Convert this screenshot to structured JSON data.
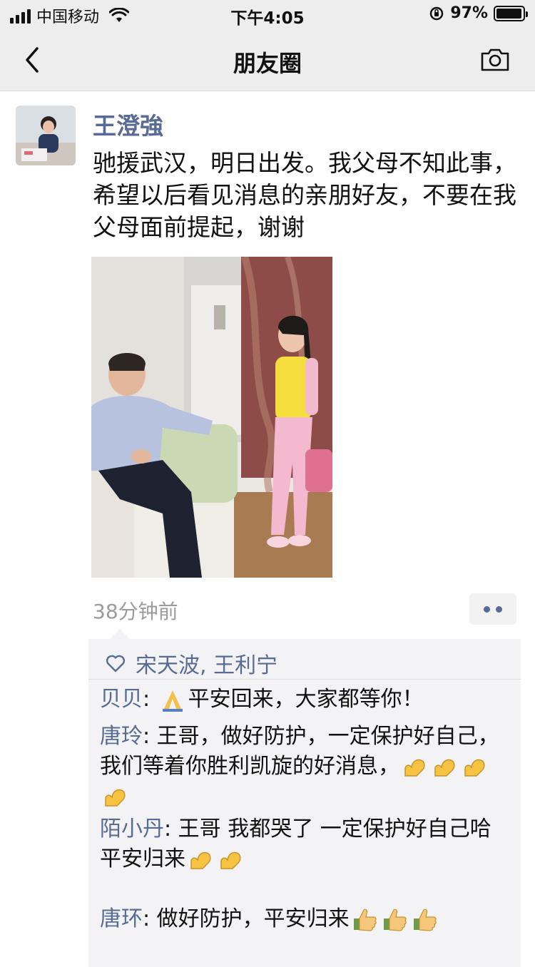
{
  "status_bar": {
    "carrier": "中国移动",
    "time": "下午4:05",
    "battery_percent": "97%",
    "battery_level": 0.97
  },
  "nav": {
    "title": "朋友圈",
    "back_icon": "chevron-left-icon",
    "camera_icon": "camera-icon"
  },
  "post": {
    "author": "王澄強",
    "text": "驰援武汉，明日出发。我父母不知此事，希望以后看见消息的亲朋好友，不要在我父母面前提起，谢谢",
    "timestamp": "38分钟前"
  },
  "likes": {
    "icon": "heart-outline-icon",
    "names": "宋天波, 王利宁"
  },
  "comments": [
    {
      "name": "贝贝",
      "sep": ": ",
      "text_before": "",
      "emoji_count": 1,
      "emoji": "folded-hands-icon",
      "text_after": "平安回来，大家都等你！"
    },
    {
      "name": "唐玲",
      "sep": ": ",
      "text": "王哥，做好防护，一定保护好自己，我们等着你胜利凯旋的好消息，",
      "emoji": "flexed-biceps-icon",
      "emoji_count": 4
    },
    {
      "name": "陌小丹",
      "sep": ": ",
      "text": "王哥 我都哭了 一定保护好自己哈",
      "line2": "平安归来",
      "emoji": "flexed-biceps-icon",
      "emoji_count": 2
    },
    {
      "name": "唐环",
      "sep": ": ",
      "text": "做好防护，平安归来",
      "emoji": "thumbs-up-icon",
      "emoji_count": 3
    }
  ],
  "colors": {
    "link": "#576b95",
    "navbar_bg": "#ededed",
    "comment_bg": "#f3f3f5",
    "timestamp": "#9b9b9b"
  }
}
